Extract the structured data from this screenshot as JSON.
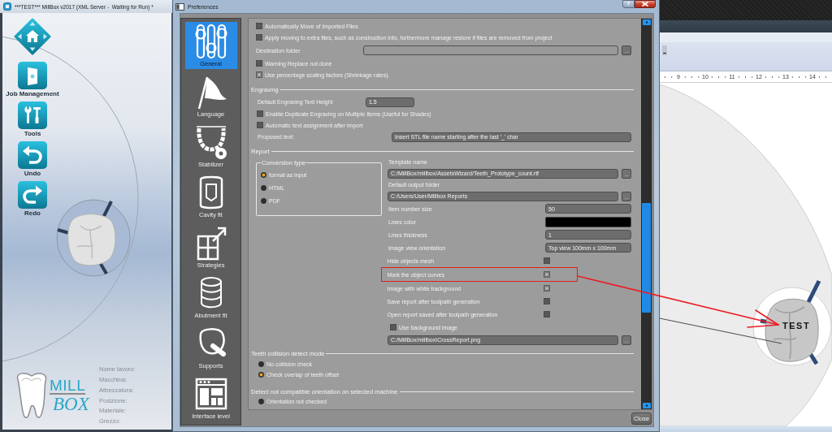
{
  "app_window": {
    "title": "***TEST*** MillBox v2017 (XML Server -  Waiting for Run) *",
    "toolbar": [
      {
        "kind": "home"
      },
      {
        "kind": "job",
        "label": "Job Management"
      },
      {
        "kind": "tools",
        "label": "Tools"
      },
      {
        "kind": "undo",
        "label": "Undo"
      },
      {
        "kind": "redo",
        "label": "Redo"
      }
    ],
    "logo": {
      "top_text": "MILL",
      "bottom_text": "BOX"
    },
    "job_info": [
      "Nome lavoro:",
      "Macchina:",
      "Attrezzatura:",
      "Posizione:",
      "Materiale:",
      "Grezzo:"
    ]
  },
  "preferences": {
    "title": "Preferences",
    "help_button": "?",
    "sidebar": [
      {
        "kind": "general",
        "label": "General",
        "selected": true
      },
      {
        "kind": "language",
        "label": "Language",
        "selected": false
      },
      {
        "kind": "stabilizer",
        "label": "Stabilizer",
        "selected": false
      },
      {
        "kind": "cavity",
        "label": "Cavity fit",
        "selected": false
      },
      {
        "kind": "strategies",
        "label": "Strategies",
        "selected": false
      },
      {
        "kind": "abutment",
        "label": "Abutment fit",
        "selected": false
      },
      {
        "kind": "supports",
        "label": "Supports",
        "selected": false
      },
      {
        "kind": "interface",
        "label": "Interface level",
        "selected": false
      }
    ],
    "general": [
      {
        "kind": "checkbox",
        "label": "Automatically Move of Imported Files",
        "checked": false
      },
      {
        "kind": "checkbox",
        "label": "Apply moving to extra files, such as construction info, furthermore manage restore if files are removed from project",
        "checked": false
      },
      {
        "kind": "folder",
        "label": "Destination folder",
        "button": "..."
      },
      {
        "kind": "checkbox",
        "label": "Warning Replace not done",
        "checked": false
      },
      {
        "kind": "checkbox",
        "label": "Use percentage scaling factors (Shrinkage rates)",
        "checked": true
      }
    ],
    "engraving": {
      "title": "Engraving",
      "items": [
        {
          "kind": "number",
          "label": "Default Engraving Text Height",
          "value": "1.5"
        },
        {
          "kind": "checkbox",
          "label": "Enable Duplicate Engraving on Multiple Items (Useful for Shades)",
          "checked": false
        },
        {
          "kind": "checkbox",
          "label": "Automatic text assignment after import",
          "checked": false
        },
        {
          "kind": "text",
          "label": "Proposed text:",
          "value": "Insert STL file name starting after the last '_' char"
        }
      ]
    },
    "report": {
      "title": "Report",
      "conversion_type": {
        "title": "Conversion type",
        "options": [
          {
            "label": "format as input",
            "selected": true
          },
          {
            "label": "HTML",
            "selected": false
          },
          {
            "label": "PDF",
            "selected": false
          }
        ]
      },
      "settings": [
        {
          "kind": "path",
          "label": "Template name",
          "value": "C:/MillBox/millbox/AssetsWizard/Teeth_Prototype_count.rtf",
          "button": "..."
        },
        {
          "kind": "path",
          "label": "Default output folder",
          "value": "C:/Users/User/Millbox Reports",
          "button": "..."
        },
        {
          "kind": "value",
          "label": "Item number size",
          "value": "50"
        },
        {
          "kind": "color",
          "label": "Lines color",
          "color": "#000000"
        },
        {
          "kind": "value",
          "label": "Lines thickness",
          "value": "1"
        },
        {
          "kind": "value",
          "label": "Image view orientation",
          "value": "Top view 100mm x 100mm"
        },
        {
          "kind": "toggle",
          "label": "Hide objects mesh",
          "checked": false,
          "highlighted": false
        },
        {
          "kind": "toggle",
          "label": "Mark the object curves",
          "checked": true,
          "highlighted": true
        },
        {
          "kind": "toggle",
          "label": "Image with white background",
          "checked": true,
          "highlighted": false
        },
        {
          "kind": "toggle",
          "label": "Save report after toolpath generation",
          "checked": false,
          "highlighted": false
        },
        {
          "kind": "toggle",
          "label": "Open report saved after toolpath generation",
          "checked": false,
          "highlighted": false
        },
        {
          "kind": "checkbox",
          "label": "Use background image",
          "checked": false
        },
        {
          "kind": "file",
          "value": "C:/MillBox/millbox\\CrossReport.png",
          "button": "..."
        }
      ]
    },
    "collision": {
      "title": "Teeth collision detect mode",
      "options": [
        {
          "label": "No collision check",
          "selected": false
        },
        {
          "label": "Check overlap of teeth offset",
          "selected": true
        }
      ]
    },
    "orientation": {
      "title": "Detect not compatible orientation on selected machine",
      "options": [
        {
          "label": "Orientation not checked",
          "selected": false
        }
      ]
    },
    "close_button": "Close"
  },
  "document_window": {
    "ruler": [
      "9",
      "10",
      "11",
      "12",
      "13",
      "14"
    ],
    "engraved_text": "TEST"
  }
}
